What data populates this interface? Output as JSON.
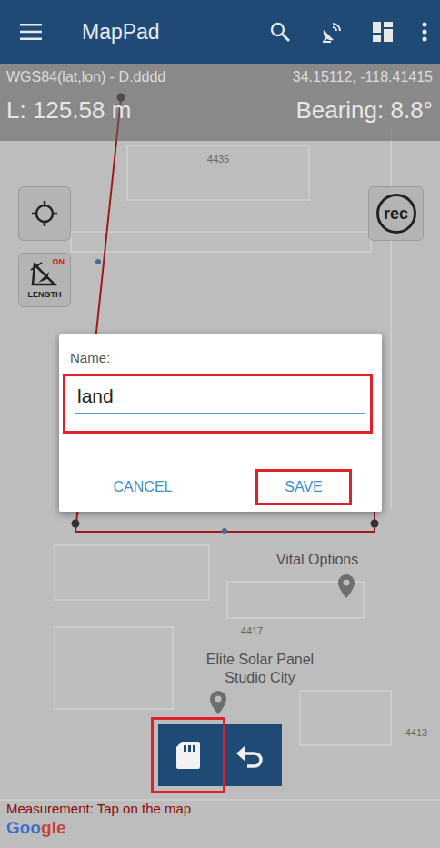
{
  "app_bar": {
    "title": "MapPad"
  },
  "info": {
    "crs": "WGS84(lat,lon) - D.dddd",
    "coordinates": "34.15112, -118.41415",
    "length": "L: 125.58 m",
    "bearing": "Bearing: 8.8°"
  },
  "map_labels": [
    {
      "lines": [
        "4435"
      ],
      "kind": "address"
    },
    {
      "lines": [
        "Vital Options"
      ],
      "kind": "place"
    },
    {
      "lines": [
        "4417"
      ],
      "kind": "address"
    },
    {
      "lines": [
        "Elite Solar Panel",
        "Studio City"
      ],
      "kind": "place"
    },
    {
      "lines": [
        "4413"
      ],
      "kind": "address"
    }
  ],
  "controls": {
    "length_toggle": {
      "state_label": "ON",
      "label": "LENGTH",
      "on": true
    },
    "record": {
      "label": "rec"
    }
  },
  "dialog": {
    "label": "Name:",
    "value": "land",
    "highlighted": true,
    "buttons": [
      {
        "label": "CANCEL",
        "highlighted": false
      },
      {
        "label": "SAVE",
        "highlighted": true
      }
    ]
  },
  "tools": [
    {
      "kind": "save",
      "highlighted": true
    },
    {
      "kind": "undo",
      "highlighted": false
    }
  ],
  "status": {
    "hint": "Measurement: Tap on the map",
    "attribution": "Google"
  }
}
